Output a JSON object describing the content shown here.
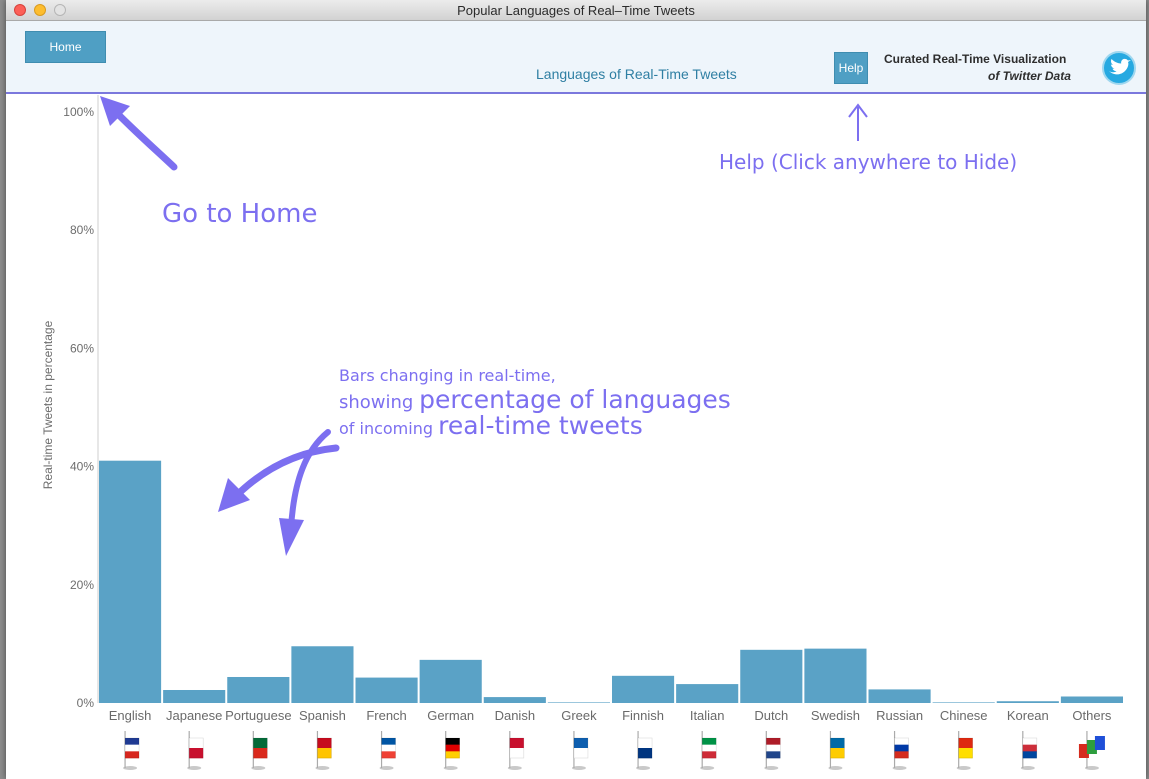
{
  "window": {
    "title": "Popular Languages of Real–Time Tweets"
  },
  "header": {
    "home_label": "Home",
    "subtitle": "Languages of Real-Time Tweets",
    "help_label": "Help",
    "brand_line1": "Curated Real-Time Visualization",
    "brand_line2": "of Twitter Data"
  },
  "annotations": {
    "home": "Go to Home",
    "help": "Help (Click anywhere to Hide)",
    "bars_line1": "Bars changing in real-time,",
    "bars_line2a": "showing ",
    "bars_line2b": "percentage of languages",
    "bars_line3a": "of incoming ",
    "bars_line3b": "real-time tweets"
  },
  "chart_data": {
    "type": "bar",
    "ylabel": "Real-time Tweets in percentage",
    "ylim": [
      0,
      100
    ],
    "yticks": [
      "0%",
      "20%",
      "40%",
      "60%",
      "80%",
      "100%"
    ],
    "categories": [
      "English",
      "Japanese",
      "Portuguese",
      "Spanish",
      "French",
      "German",
      "Danish",
      "Greek",
      "Finnish",
      "Italian",
      "Dutch",
      "Swedish",
      "Russian",
      "Chinese",
      "Korean",
      "Others"
    ],
    "values": [
      41,
      2.2,
      4.4,
      9.6,
      4.3,
      7.3,
      1.0,
      0.1,
      4.6,
      3.2,
      9.0,
      9.2,
      2.3,
      0,
      0.3,
      1.1
    ],
    "bar_color": "#5aa2c6"
  },
  "flags": [
    {
      "language": "English",
      "icon": "uk-flag-icon",
      "colors": [
        "#1f3a93",
        "#ffffff",
        "#d7261e"
      ]
    },
    {
      "language": "Japanese",
      "icon": "japan-flag-icon",
      "colors": [
        "#ffffff",
        "#c8102e"
      ]
    },
    {
      "language": "Portuguese",
      "icon": "portugal-flag-icon",
      "colors": [
        "#046a38",
        "#da291c"
      ]
    },
    {
      "language": "Spanish",
      "icon": "spain-flag-icon",
      "colors": [
        "#c60b1e",
        "#ffc400"
      ]
    },
    {
      "language": "French",
      "icon": "france-flag-icon",
      "colors": [
        "#0055a4",
        "#ffffff",
        "#ef4135"
      ]
    },
    {
      "language": "German",
      "icon": "germany-flag-icon",
      "colors": [
        "#000000",
        "#dd0000",
        "#ffce00"
      ]
    },
    {
      "language": "Danish",
      "icon": "denmark-flag-icon",
      "colors": [
        "#c8102e",
        "#ffffff"
      ]
    },
    {
      "language": "Greek",
      "icon": "greece-flag-icon",
      "colors": [
        "#0d5eaf",
        "#ffffff"
      ]
    },
    {
      "language": "Finnish",
      "icon": "finland-flag-icon",
      "colors": [
        "#ffffff",
        "#003580"
      ]
    },
    {
      "language": "Italian",
      "icon": "italy-flag-icon",
      "colors": [
        "#009246",
        "#ffffff",
        "#ce2b37"
      ]
    },
    {
      "language": "Dutch",
      "icon": "netherlands-flag-icon",
      "colors": [
        "#ae1c28",
        "#ffffff",
        "#21468b"
      ]
    },
    {
      "language": "Swedish",
      "icon": "sweden-flag-icon",
      "colors": [
        "#006aa7",
        "#fecc00"
      ]
    },
    {
      "language": "Russian",
      "icon": "russia-flag-icon",
      "colors": [
        "#ffffff",
        "#0039a6",
        "#d52b1e"
      ]
    },
    {
      "language": "Chinese",
      "icon": "china-flag-icon",
      "colors": [
        "#de2910",
        "#ffde00"
      ]
    },
    {
      "language": "Korean",
      "icon": "korea-flag-icon",
      "colors": [
        "#ffffff",
        "#cd2e3a",
        "#0047a0"
      ]
    },
    {
      "language": "Others",
      "icon": "multiple-flags-icon",
      "colors": [
        "#d52b1e",
        "#2e9e3e",
        "#1f4fd8"
      ]
    }
  ],
  "colors": {
    "accent": "#7b78dd",
    "button": "#4f9fc4",
    "annotation": "#7c6ff0"
  }
}
